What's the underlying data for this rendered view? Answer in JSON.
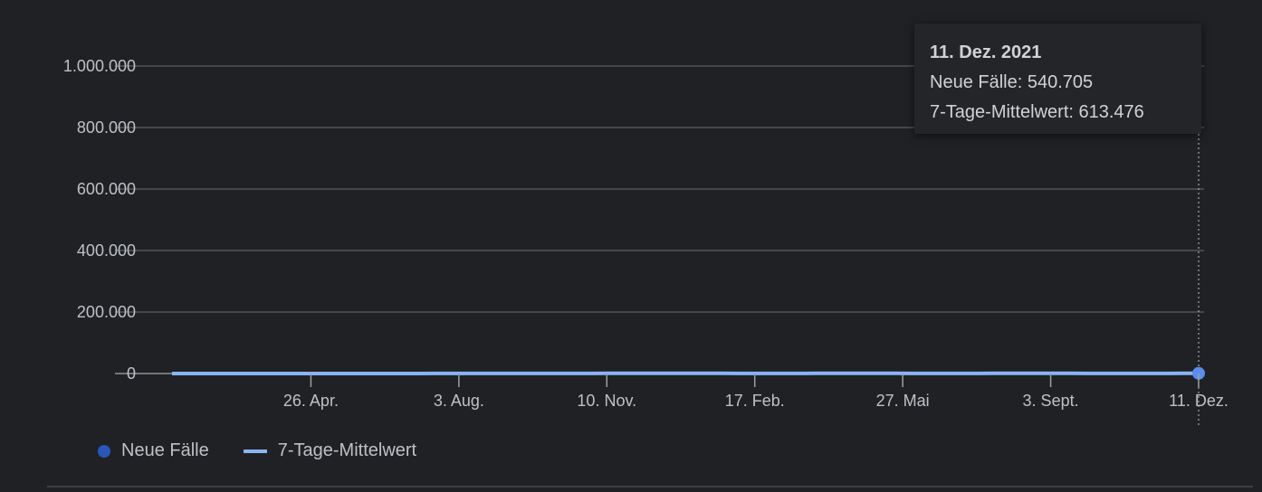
{
  "chart_data": {
    "type": "area",
    "title": "",
    "xlabel": "",
    "ylabel": "",
    "ylim": [
      0,
      1000000
    ],
    "xlim_days": [
      0,
      680
    ],
    "y_ticks": [
      {
        "value": 0,
        "label": "0"
      },
      {
        "value": 200000,
        "label": "200.000"
      },
      {
        "value": 400000,
        "label": "400.000"
      },
      {
        "value": 600000,
        "label": "600.000"
      },
      {
        "value": 800000,
        "label": "800.000"
      },
      {
        "value": 1000000,
        "label": "1.000.000"
      }
    ],
    "x_ticks": [
      {
        "day": 92,
        "label": "26. Apr."
      },
      {
        "day": 190,
        "label": "3. Aug."
      },
      {
        "day": 288,
        "label": "10. Nov."
      },
      {
        "day": 386,
        "label": "17. Feb."
      },
      {
        "day": 484,
        "label": "27. Mai"
      },
      {
        "day": 582,
        "label": "3. Sept."
      },
      {
        "day": 680,
        "label": "11. Dez."
      }
    ],
    "x_days": [
      0,
      24,
      48,
      60,
      69,
      78,
      90,
      102,
      114,
      126,
      138,
      150,
      162,
      174,
      186,
      198,
      210,
      222,
      234,
      246,
      258,
      270,
      279,
      288,
      300,
      309,
      318,
      330,
      339,
      348,
      357,
      366,
      375,
      384,
      393,
      402,
      414,
      426,
      435,
      441,
      447,
      453,
      462,
      471,
      480,
      489,
      498,
      507,
      516,
      525,
      534,
      543,
      552,
      561,
      570,
      579,
      588,
      597,
      606,
      615,
      624,
      633,
      642,
      651,
      660,
      669,
      675,
      680
    ],
    "series": [
      {
        "name": "Neue Fälle",
        "color": "#2a50a8",
        "values": [
          0,
          2,
          6,
          25,
          80,
          95,
          80,
          88,
          95,
          118,
          130,
          155,
          190,
          220,
          265,
          270,
          260,
          280,
          300,
          310,
          330,
          420,
          540,
          620,
          640,
          650,
          670,
          680,
          640,
          890,
          700,
          580,
          440,
          330,
          400,
          410,
          470,
          600,
          650,
          760,
          880,
          900,
          860,
          760,
          620,
          480,
          390,
          330,
          390,
          450,
          540,
          620,
          700,
          770,
          760,
          700,
          640,
          560,
          480,
          420,
          380,
          400,
          440,
          480,
          580,
          690,
          720,
          540
        ]
      },
      {
        "name": "7-Tage-Mittelwert",
        "color": "#8ab4f8",
        "values": [
          0,
          2,
          5,
          20,
          75,
          80,
          78,
          82,
          90,
          110,
          125,
          145,
          180,
          210,
          250,
          260,
          255,
          270,
          285,
          295,
          320,
          400,
          500,
          580,
          595,
          610,
          640,
          650,
          600,
          745,
          680,
          560,
          430,
          370,
          385,
          390,
          450,
          560,
          620,
          720,
          800,
          825,
          810,
          740,
          600,
          460,
          380,
          360,
          375,
          430,
          510,
          580,
          620,
          650,
          660,
          655,
          620,
          560,
          500,
          460,
          410,
          415,
          430,
          460,
          530,
          570,
          620,
          613
        ]
      }
    ],
    "legend": {
      "placement": "bottom-left",
      "entries": [
        "Neue Fälle",
        "7-Tage-Mittelwert"
      ]
    },
    "grid": true,
    "tooltip": {
      "title": "11. Dez. 2021",
      "line1": "Neue Fälle: 540.705",
      "line2": "7-Tage-Mittelwert: 613.476"
    }
  },
  "legend": {
    "cases": "Neue Fälle",
    "average": "7-Tage-Mittelwert"
  }
}
